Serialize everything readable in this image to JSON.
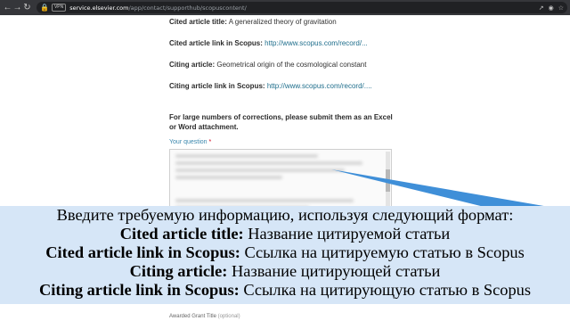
{
  "browser": {
    "vpn_label": "VPN",
    "url_domain": "service.elsevier.com",
    "url_path": "/app/contact/supporthub/scopuscontent/"
  },
  "form": {
    "rows": [
      {
        "label": "Cited article title:",
        "value": "A generalized theory of gravitation",
        "is_link": false
      },
      {
        "label": "Cited article link in Scopus:",
        "value": "http://www.scopus.com/record/...",
        "is_link": true
      },
      {
        "label": "Citing article:",
        "value": "Geometrical origin of the cosmological constant",
        "is_link": false
      },
      {
        "label": "Citing article link in Scopus:",
        "value": "http://www.scopus.com/record/....",
        "is_link": true
      }
    ],
    "note": "For large numbers of corrections, please submit them as an Excel or Word attachment.",
    "question_label": "Your question",
    "required_mark": "*",
    "awarded_label": "Awarded Grant Title",
    "awarded_optional": "(optional)"
  },
  "overlay": {
    "intro": "Введите требуемую информацию, используя следующий формат:",
    "lines": [
      {
        "label": "Cited article title:",
        "text": "Название цитируемой статьи"
      },
      {
        "label": "Cited article link in Scopus:",
        "text": "Ссылка на цитируемую статью в Scopus"
      },
      {
        "label": "Citing article:",
        "text": "Название цитирующей статьи"
      },
      {
        "label": "Citing article link in Scopus:",
        "text": "Ссылка на цитирующую статью в Scopus"
      }
    ]
  },
  "colors": {
    "overlay_bg": "#d6e6f7",
    "pointer": "#3f8fd8",
    "link": "#1f6e8c",
    "question_label": "#3a87ad"
  }
}
